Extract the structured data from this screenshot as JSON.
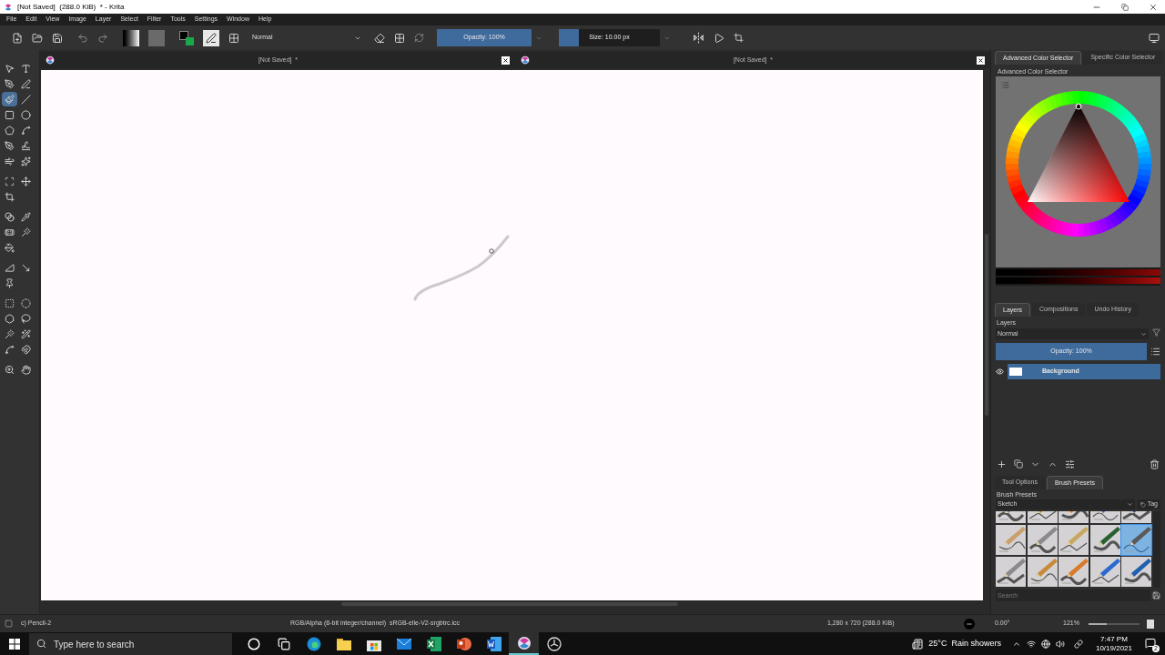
{
  "window": {
    "title": "[Not Saved]  (288.0 KiB)  * - Krita"
  },
  "menu": [
    "File",
    "Edit",
    "View",
    "Image",
    "Layer",
    "Select",
    "Filter",
    "Tools",
    "Settings",
    "Window",
    "Help"
  ],
  "toolbar": {
    "blend_mode": "Normal",
    "opacity": {
      "label": "Opacity: 100%",
      "level": 1
    },
    "size": {
      "label": "Size: 10.00 px",
      "level": 0.2
    }
  },
  "tool_groups": [
    {
      "tools": [
        {
          "kind": "pointer",
          "selected": false
        },
        {
          "kind": "text",
          "selected": false
        },
        {
          "kind": "calligraphy",
          "selected": false
        },
        {
          "kind": "pen",
          "selected": false
        },
        {
          "kind": "brush",
          "selected": true
        },
        {
          "kind": "line",
          "selected": false
        },
        {
          "kind": "rectangle",
          "selected": false
        },
        {
          "kind": "ellipse",
          "selected": false
        },
        {
          "kind": "polygon",
          "selected": false
        },
        {
          "kind": "polyline",
          "selected": false
        },
        {
          "kind": "bezier",
          "selected": false
        },
        {
          "kind": "path",
          "selected": false
        },
        {
          "kind": "dynamic",
          "selected": false
        },
        {
          "kind": "multibrush",
          "selected": false
        }
      ]
    },
    {
      "tools": [
        {
          "kind": "transform",
          "selected": false
        },
        {
          "kind": "move",
          "selected": false
        },
        {
          "kind": "crop",
          "selected": false
        }
      ]
    },
    {
      "tools": [
        {
          "kind": "gradient",
          "selected": false
        },
        {
          "kind": "picker",
          "selected": false
        },
        {
          "kind": "patch",
          "selected": false
        },
        {
          "kind": "wand",
          "selected": false
        },
        {
          "kind": "fill",
          "selected": false
        }
      ]
    },
    {
      "tools": [
        {
          "kind": "measure",
          "selected": false
        },
        {
          "kind": "reference",
          "selected": false
        },
        {
          "kind": "pin",
          "selected": false
        }
      ]
    },
    {
      "tools": [
        {
          "kind": "rect_select",
          "selected": false
        },
        {
          "kind": "ellipse_select",
          "selected": false
        },
        {
          "kind": "polygon_select",
          "selected": false
        },
        {
          "kind": "lasso",
          "selected": false
        },
        {
          "kind": "contiguous_select",
          "selected": false
        },
        {
          "kind": "similar_select",
          "selected": false
        },
        {
          "kind": "bezier_select",
          "selected": false
        },
        {
          "kind": "magnetic_select",
          "selected": false
        }
      ]
    },
    {
      "tools": [
        {
          "kind": "zoom",
          "selected": false
        },
        {
          "kind": "pan",
          "selected": false
        }
      ]
    }
  ],
  "document_tabs": [
    {
      "title": "[Not Saved]  *"
    },
    {
      "title": "[Not Saved]  *"
    }
  ],
  "color_dock": {
    "tabs": [
      {
        "label": "Advanced Color Selector",
        "selected": true
      },
      {
        "label": "Specific Color Selector",
        "selected": false
      }
    ],
    "title": "Advanced Color Selector"
  },
  "layers_dock": {
    "tabs": [
      {
        "label": "Layers",
        "selected": true
      },
      {
        "label": "Compositions",
        "selected": false
      },
      {
        "label": "Undo History",
        "selected": false
      }
    ],
    "title": "Layers",
    "blend_mode": "Normal",
    "opacity": {
      "label": "Opacity:  100%",
      "level": 1
    },
    "layers": [
      {
        "name": "Background",
        "selected": true,
        "visible": true
      }
    ]
  },
  "brush_dock": {
    "tabs": [
      {
        "label": "Tool Options",
        "selected": false
      },
      {
        "label": "Brush Presets",
        "selected": true
      }
    ],
    "title": "Brush Presets",
    "tag_filter": "Sketch",
    "tag_button": "Tag",
    "search_placeholder": "Search",
    "presets": [
      {
        "selected": false
      },
      {
        "selected": false
      },
      {
        "selected": false
      },
      {
        "selected": false
      },
      {
        "selected": false
      },
      {
        "selected": false
      },
      {
        "selected": false
      },
      {
        "selected": false
      },
      {
        "selected": false
      },
      {
        "selected": true
      },
      {
        "selected": false
      },
      {
        "selected": false
      },
      {
        "selected": false
      },
      {
        "selected": false
      },
      {
        "selected": false
      }
    ]
  },
  "status_bar": {
    "brush": "c) Pencil-2",
    "color_space": "RGB/Alpha (8-bit integer/channel)  sRGB-elle-V2-srgbtrc.icc",
    "image_size": "1,280 x 720 (288.0 KiB)",
    "rotation": "0.00°",
    "zoom": "121%",
    "zoom_slider": {
      "level": 0.35
    }
  },
  "taskbar": {
    "search_placeholder": "Type here to search",
    "apps": [
      {
        "kind": "cortana",
        "active": false
      },
      {
        "kind": "taskview",
        "active": false
      },
      {
        "kind": "browser",
        "active": false
      },
      {
        "kind": "folder",
        "active": false
      },
      {
        "kind": "store",
        "active": false
      },
      {
        "kind": "mail",
        "active": false
      },
      {
        "kind": "sheet",
        "active": false
      },
      {
        "kind": "slides",
        "active": false
      },
      {
        "kind": "doc",
        "active": false
      },
      {
        "kind": "krita",
        "active": true
      },
      {
        "kind": "recorder",
        "active": false
      }
    ],
    "weather": "25°C  Rain showers",
    "time": "7:47 PM",
    "date": "10/19/2021",
    "notifications": "2"
  }
}
